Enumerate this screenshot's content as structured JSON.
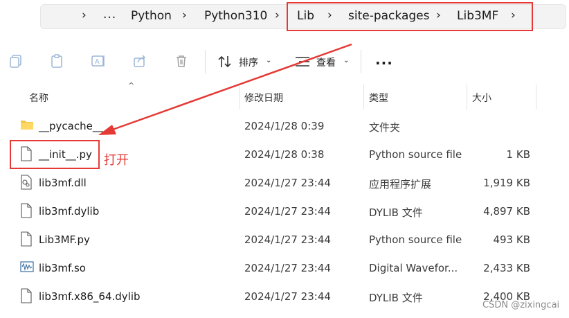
{
  "breadcrumb": {
    "items": [
      "...",
      "Python",
      "Python310",
      "Lib",
      "site-packages",
      "Lib3MF"
    ]
  },
  "toolbar": {
    "sort_label": "排序",
    "view_label": "查看",
    "more_label": "..."
  },
  "columns": {
    "name": "名称",
    "date": "修改日期",
    "type": "类型",
    "size": "大小"
  },
  "files": [
    {
      "name": "__pycache__",
      "date": "2024/1/28 0:39",
      "type": "文件夹",
      "size": "",
      "icon": "folder-icon"
    },
    {
      "name": "__init__.py",
      "date": "2024/1/28 0:38",
      "type": "Python source file",
      "size": "1 KB",
      "icon": "file-icon"
    },
    {
      "name": "lib3mf.dll",
      "date": "2024/1/27 23:44",
      "type": "应用程序扩展",
      "size": "1,919 KB",
      "icon": "dll-file-icon"
    },
    {
      "name": "lib3mf.dylib",
      "date": "2024/1/27 23:44",
      "type": "DYLIB 文件",
      "size": "4,897 KB",
      "icon": "file-icon"
    },
    {
      "name": "Lib3MF.py",
      "date": "2024/1/27 23:44",
      "type": "Python source file",
      "size": "493 KB",
      "icon": "file-icon"
    },
    {
      "name": "lib3mf.so",
      "date": "2024/1/27 23:44",
      "type": "Digital Wavefor...",
      "size": "2,433 KB",
      "icon": "waveform-file-icon"
    },
    {
      "name": "lib3mf.x86_64.dylib",
      "date": "2024/1/27 23:44",
      "type": "DYLIB 文件",
      "size": "2,400 KB",
      "icon": "file-icon"
    }
  ],
  "annotation": {
    "open_label": "打开",
    "color": "#e53935"
  },
  "watermark": "CSDN @zixingcai"
}
